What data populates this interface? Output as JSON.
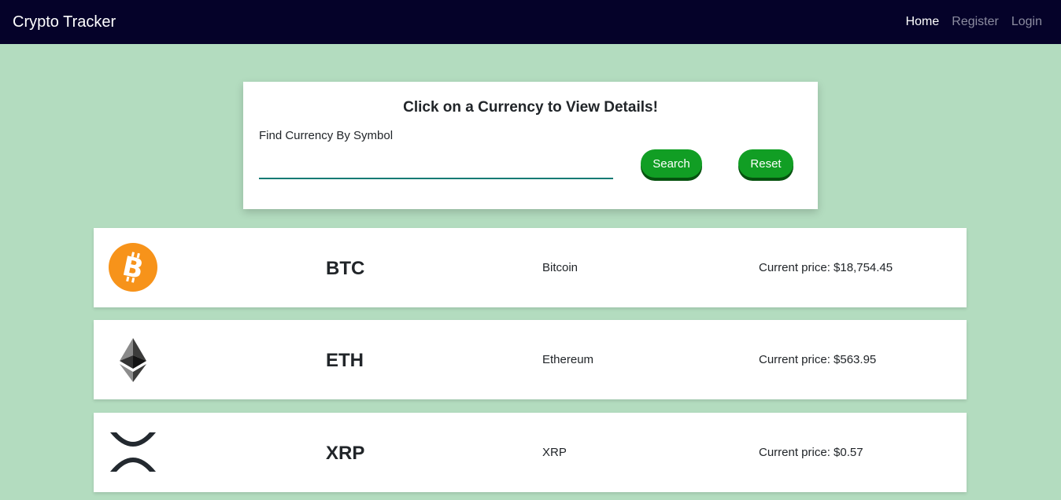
{
  "navbar": {
    "brand": "Crypto Tracker",
    "links": [
      {
        "label": "Home",
        "active": true
      },
      {
        "label": "Register",
        "active": false
      },
      {
        "label": "Login",
        "active": false
      }
    ]
  },
  "search": {
    "title": "Click on a Currency to View Details!",
    "label": "Find Currency By Symbol",
    "value": "",
    "search_button": "Search",
    "reset_button": "Reset"
  },
  "coins": [
    {
      "symbol": "BTC",
      "name": "Bitcoin",
      "price": "Current price: $18,754.45",
      "icon": "bitcoin-icon"
    },
    {
      "symbol": "ETH",
      "name": "Ethereum",
      "price": "Current price: $563.95",
      "icon": "ethereum-icon"
    },
    {
      "symbol": "XRP",
      "name": "XRP",
      "price": "Current price: $0.57",
      "icon": "xrp-icon"
    }
  ],
  "colors": {
    "navbar": "#050229",
    "background": "#b3dcbf",
    "button": "#119e24",
    "input_underline": "#127a74",
    "bitcoin": "#f7931a"
  }
}
